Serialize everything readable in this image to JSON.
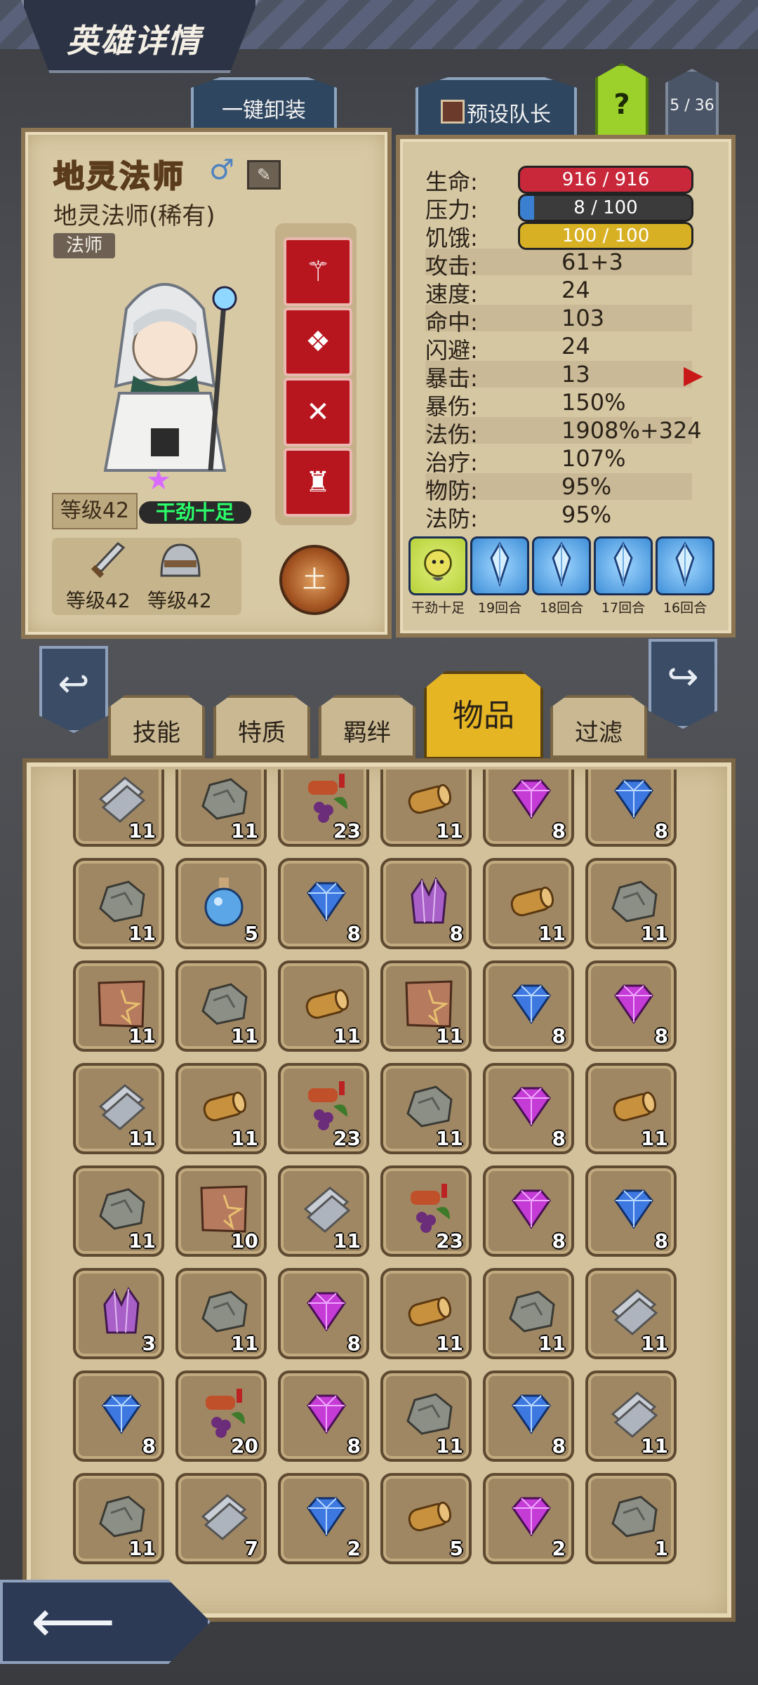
{
  "header": {
    "title": "英雄详情"
  },
  "top_tabs": {
    "unequip_label": "一键卸装",
    "captain_label": "预设队长",
    "help_label": "?",
    "page_count": "5 / 36"
  },
  "hero": {
    "name": "地灵法师",
    "subtitle": "地灵法师(稀有)",
    "class": "法师",
    "level": "等级42",
    "mood": "干劲十足",
    "weapon_level": "等级42",
    "armor_level": "等级42",
    "element": "土",
    "equip_icons": [
      "staff-icon",
      "book-icon",
      "crossed-blades-icon",
      "cloak-icon"
    ]
  },
  "stats": {
    "bars": [
      {
        "label": "生命:",
        "value": "916 / 916",
        "fill": 1.0,
        "color": "#c8283a"
      },
      {
        "label": "压力:",
        "value": "8 / 100",
        "fill": 0.08,
        "color": "#3b7fd0"
      },
      {
        "label": "饥饿:",
        "value": "100 / 100",
        "fill": 1.0,
        "color": "#d8b024"
      }
    ],
    "rows": [
      {
        "label": "攻击:",
        "value": "61+3"
      },
      {
        "label": "速度:",
        "value": "24"
      },
      {
        "label": "命中:",
        "value": "103"
      },
      {
        "label": "闪避:",
        "value": "24"
      },
      {
        "label": "暴击:",
        "value": "13"
      },
      {
        "label": "暴伤:",
        "value": "150%"
      },
      {
        "label": "法伤:",
        "value": "1908%+324"
      },
      {
        "label": "治疗:",
        "value": "107%"
      },
      {
        "label": "物防:",
        "value": "95%"
      },
      {
        "label": "法防:",
        "value": "95%"
      }
    ]
  },
  "buffs": [
    {
      "icon": "lightbulb-face-icon",
      "label": "干劲十足",
      "color": "#b7d13a"
    },
    {
      "icon": "crystal-icon",
      "label": "19回合",
      "color": "#3f8fd8"
    },
    {
      "icon": "crystal-icon",
      "label": "18回合",
      "color": "#3f8fd8"
    },
    {
      "icon": "crystal-icon",
      "label": "17回合",
      "color": "#3f8fd8"
    },
    {
      "icon": "crystal-icon",
      "label": "16回合",
      "color": "#3f8fd8"
    }
  ],
  "category_tabs": [
    "技能",
    "特质",
    "羁绊",
    "物品",
    "过滤"
  ],
  "active_tab": "物品",
  "inventory": [
    [
      {
        "item": "iron",
        "qty": "11"
      },
      {
        "item": "stone",
        "qty": "11"
      },
      {
        "item": "food",
        "qty": "23"
      },
      {
        "item": "wood",
        "qty": "11"
      },
      {
        "item": "purple-gem",
        "qty": "8"
      },
      {
        "item": "blue-gem",
        "qty": "8"
      }
    ],
    [
      {
        "item": "stone",
        "qty": "11"
      },
      {
        "item": "potion",
        "qty": "5"
      },
      {
        "item": "blue-gem",
        "qty": "8"
      },
      {
        "item": "crystal",
        "qty": "8"
      },
      {
        "item": "wood",
        "qty": "11"
      },
      {
        "item": "stone",
        "qty": "11"
      }
    ],
    [
      {
        "item": "hide",
        "qty": "11"
      },
      {
        "item": "stone",
        "qty": "11"
      },
      {
        "item": "wood",
        "qty": "11"
      },
      {
        "item": "hide",
        "qty": "11"
      },
      {
        "item": "blue-gem",
        "qty": "8"
      },
      {
        "item": "purple-gem",
        "qty": "8"
      }
    ],
    [
      {
        "item": "iron",
        "qty": "11"
      },
      {
        "item": "wood",
        "qty": "11"
      },
      {
        "item": "food",
        "qty": "23"
      },
      {
        "item": "stone",
        "qty": "11"
      },
      {
        "item": "purple-gem",
        "qty": "8"
      },
      {
        "item": "wood",
        "qty": "11"
      }
    ],
    [
      {
        "item": "stone",
        "qty": "11"
      },
      {
        "item": "hide",
        "qty": "10"
      },
      {
        "item": "iron",
        "qty": "11"
      },
      {
        "item": "food",
        "qty": "23"
      },
      {
        "item": "purple-gem",
        "qty": "8"
      },
      {
        "item": "blue-gem",
        "qty": "8"
      }
    ],
    [
      {
        "item": "crystal",
        "qty": "3"
      },
      {
        "item": "stone",
        "qty": "11"
      },
      {
        "item": "purple-gem",
        "qty": "8"
      },
      {
        "item": "wood",
        "qty": "11"
      },
      {
        "item": "stone",
        "qty": "11"
      },
      {
        "item": "iron",
        "qty": "11"
      }
    ],
    [
      {
        "item": "blue-gem",
        "qty": "8"
      },
      {
        "item": "food",
        "qty": "20"
      },
      {
        "item": "purple-gem",
        "qty": "8"
      },
      {
        "item": "stone",
        "qty": "11"
      },
      {
        "item": "blue-gem",
        "qty": "8"
      },
      {
        "item": "iron",
        "qty": "11"
      }
    ],
    [
      {
        "item": "stone",
        "qty": "11"
      },
      {
        "item": "iron",
        "qty": "7"
      },
      {
        "item": "blue-gem",
        "qty": "2"
      },
      {
        "item": "wood",
        "qty": "5"
      },
      {
        "item": "purple-gem",
        "qty": "2"
      },
      {
        "item": "stone",
        "qty": "1"
      }
    ]
  ]
}
